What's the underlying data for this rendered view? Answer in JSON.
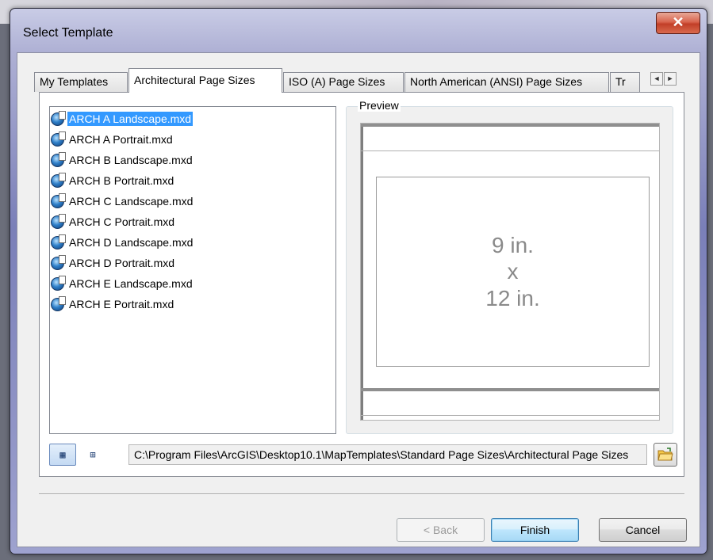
{
  "window": {
    "title": "Select Template",
    "close_glyph": "✕"
  },
  "tabs": [
    {
      "label": "My Templates"
    },
    {
      "label": "Architectural Page Sizes",
      "active": true
    },
    {
      "label": "ISO (A) Page Sizes"
    },
    {
      "label": "North American (ANSI) Page Sizes"
    },
    {
      "label": "Tr"
    }
  ],
  "tab_scroll": {
    "left_glyph": "◄",
    "right_glyph": "►"
  },
  "files": [
    {
      "label": "ARCH A Landscape.mxd",
      "selected": true
    },
    {
      "label": "ARCH A Portrait.mxd"
    },
    {
      "label": "ARCH B Landscape.mxd"
    },
    {
      "label": "ARCH B Portrait.mxd"
    },
    {
      "label": "ARCH C Landscape.mxd"
    },
    {
      "label": "ARCH C Portrait.mxd"
    },
    {
      "label": "ARCH D Landscape.mxd"
    },
    {
      "label": "ARCH D Portrait.mxd"
    },
    {
      "label": "ARCH E Landscape.mxd"
    },
    {
      "label": "ARCH E Portrait.mxd"
    }
  ],
  "preview": {
    "legend": "Preview",
    "line1": "9 in.",
    "line2": "x",
    "line3": "12 in."
  },
  "path": {
    "value": "C:\\Program Files\\ArcGIS\\Desktop10.1\\MapTemplates\\Standard Page Sizes\\Architectural Page Sizes"
  },
  "buttons": {
    "back": "< Back",
    "finish": "Finish",
    "cancel": "Cancel"
  },
  "colors": {
    "selection": "#3399ff",
    "default_button": "#3c7fb1",
    "close_button": "#c23f28"
  }
}
